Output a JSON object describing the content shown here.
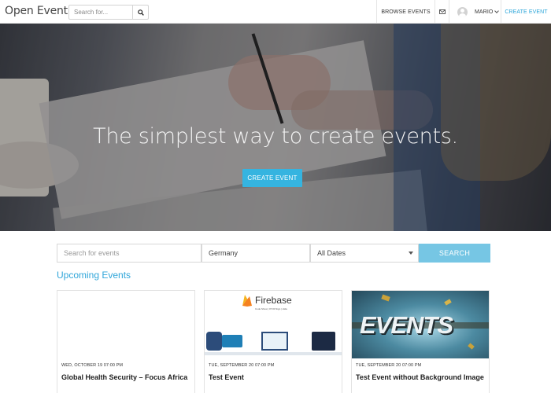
{
  "app": {
    "brand": "Open Event"
  },
  "nav": {
    "search_placeholder": "Search for...",
    "browse_label": "BROWSE EVENTS",
    "user_name": "MARIO",
    "create_label": "CREATE EVENT"
  },
  "hero": {
    "title": "The simplest way to create events.",
    "button_label": "CREATE EVENT"
  },
  "search": {
    "events_placeholder": "Search for events",
    "location_value": "Germany",
    "date_value": "All Dates",
    "button_label": "SEARCH"
  },
  "upcoming": {
    "heading": "Upcoming Events"
  },
  "events": [
    {
      "date": "WED, OCTOBER 19 07:00 PM",
      "title": "Global Health Security – Focus Africa"
    },
    {
      "date": "TUE, SEPTEMBER 20 07:00 PM",
      "title": "Test Event",
      "image_text": "Firebase",
      "image_subtext": "Code Show | 07:00 Sign | slide"
    },
    {
      "date": "TUE, SEPTEMBER 20 07:00 PM",
      "title": "Test Event without Background Image",
      "image_text": "EVENTS"
    }
  ],
  "colors": {
    "accent": "#2aa5d9",
    "button": "#35b4e0",
    "search_button": "#76c6e4"
  },
  "icons": [
    "search-icon",
    "mail-icon",
    "user-avatar-icon",
    "caret-down-icon"
  ]
}
